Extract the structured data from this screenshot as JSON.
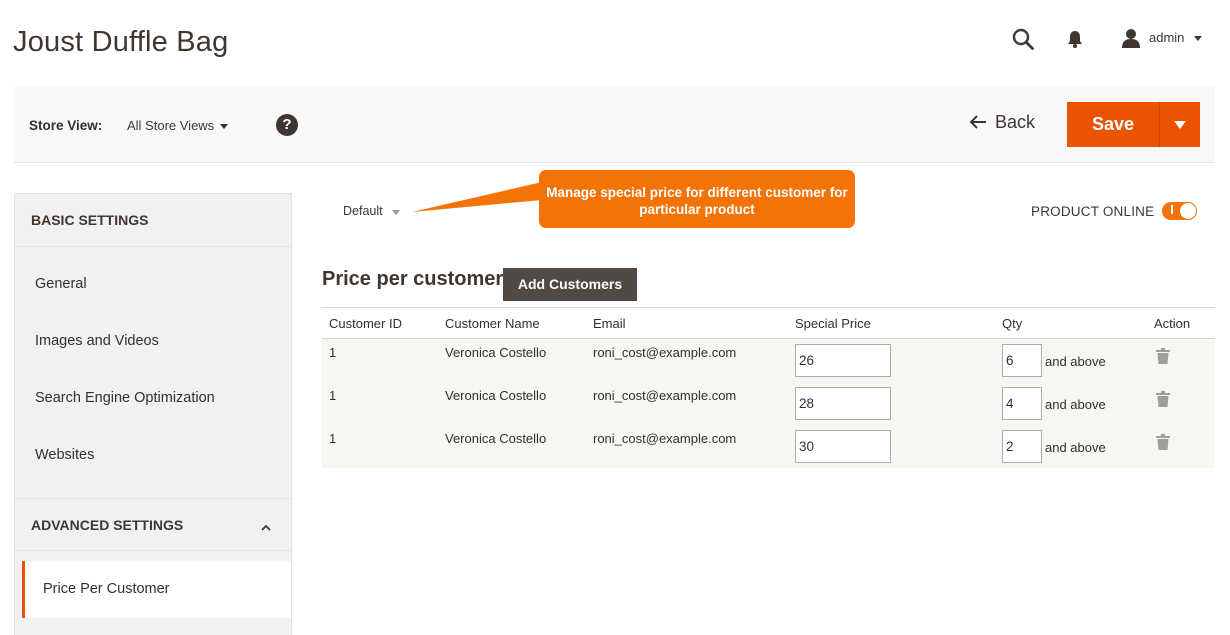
{
  "header": {
    "title": "Joust Duffle Bag",
    "user": "admin"
  },
  "toolbar": {
    "store_view_label": "Store View:",
    "store_view_value": "All Store Views",
    "help": "?",
    "back_label": "Back",
    "save_label": "Save"
  },
  "sidebar": {
    "basic_heading": "BASIC SETTINGS",
    "items": [
      {
        "label": "General"
      },
      {
        "label": "Images and Videos"
      },
      {
        "label": "Search Engine Optimization"
      },
      {
        "label": "Websites"
      }
    ],
    "advanced_heading": "ADVANCED SETTINGS",
    "active_item": "Price Per Customer"
  },
  "main": {
    "scope": "Default",
    "callout": "Manage special price for different customer for particular product",
    "product_online_label": "PRODUCT ONLINE",
    "product_online": true,
    "section_title": "Price per customer",
    "add_customers_label": "Add Customers"
  },
  "grid": {
    "columns": [
      "Customer ID",
      "Customer Name",
      "Email",
      "Special Price",
      "Qty",
      "Action"
    ],
    "qty_suffix": "and above",
    "rows": [
      {
        "id": "1",
        "name": "Veronica Costello",
        "email": "roni_cost@example.com",
        "price": "26",
        "qty": "6"
      },
      {
        "id": "1",
        "name": "Veronica Costello",
        "email": "roni_cost@example.com",
        "price": "28",
        "qty": "4"
      },
      {
        "id": "1",
        "name": "Veronica Costello",
        "email": "roni_cost@example.com",
        "price": "30",
        "qty": "2"
      }
    ]
  },
  "colors": {
    "accent": "#eb5202",
    "callout": "#f47306",
    "dark_button": "#514943"
  }
}
